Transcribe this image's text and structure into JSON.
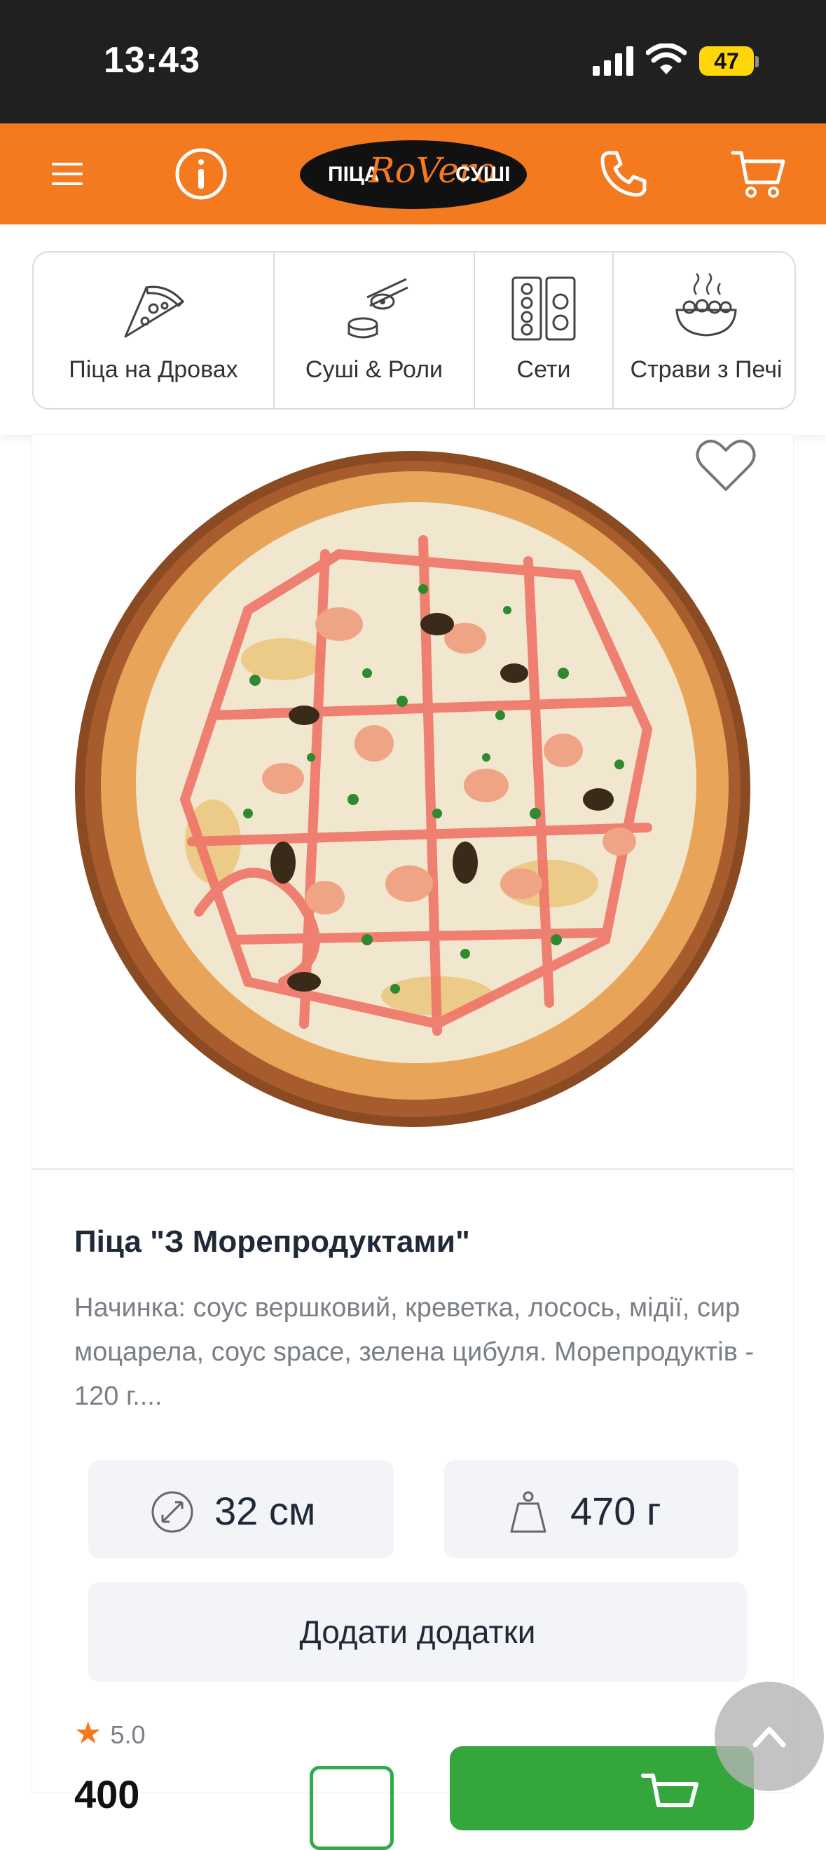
{
  "status_bar": {
    "time": "13:43",
    "battery": "47"
  },
  "header": {
    "menu_icon": "hamburger-menu-icon",
    "info_icon": "info-icon",
    "logo": {
      "left": "ПІЦА",
      "script": "RoVero",
      "right": "СУШІ"
    },
    "phone_icon": "phone-icon",
    "cart_icon": "cart-icon"
  },
  "categories": [
    {
      "label": "Піца на Дровах",
      "icon": "pizza-slice-icon"
    },
    {
      "label": "Суші & Роли",
      "icon": "sushi-icon"
    },
    {
      "label": "Сети",
      "icon": "sushi-set-icon"
    },
    {
      "label": "Страви з Печі",
      "icon": "bowl-icon"
    }
  ],
  "product": {
    "title": "Піца \"З Морепродуктами\"",
    "description": "Начинка: соус вершковий, креветка, лосось, мідії, сир моцарела, соус space, зелена цибуля. Морепродуктів - 120 г....",
    "size": "32 см",
    "weight": "470 г",
    "addons_label": "Додати додатки",
    "rating": "5.0",
    "price": "400"
  },
  "colors": {
    "brand": "#f47a20",
    "buy": "#35a63c"
  }
}
